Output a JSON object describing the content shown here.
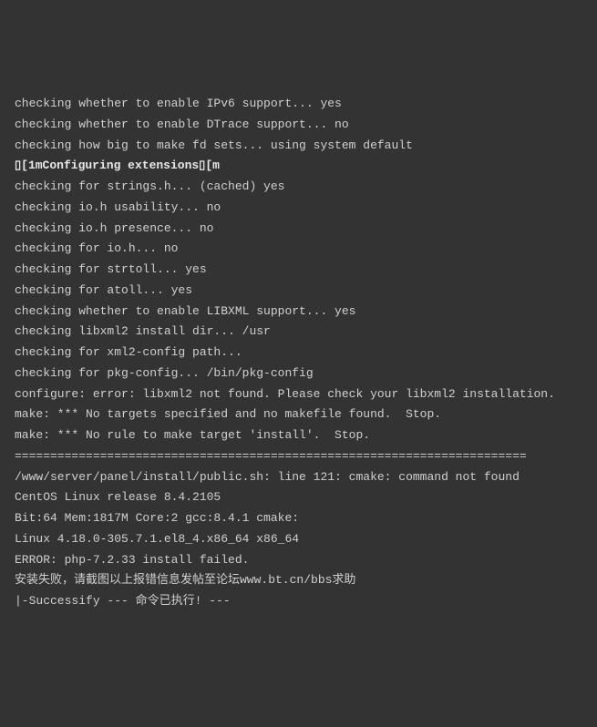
{
  "terminal": {
    "lines": [
      "checking whether to enable IPv6 support... yes",
      "checking whether to enable DTrace support... no",
      "checking how big to make fd sets... using system default",
      "",
      "\u001b[1mConfiguring extensions\u001b[m",
      "checking for strings.h... (cached) yes",
      "checking io.h usability... no",
      "checking io.h presence... no",
      "checking for io.h... no",
      "checking for strtoll... yes",
      "checking for atoll... yes",
      "checking whether to enable LIBXML support... yes",
      "checking libxml2 install dir... /usr",
      "checking for xml2-config path...",
      "checking for pkg-config... /bin/pkg-config",
      "configure: error: libxml2 not found. Please check your libxml2 installation.",
      "make: *** No targets specified and no makefile found.  Stop.",
      "make: *** No rule to make target 'install'.  Stop.",
      "========================================================================",
      "/www/server/panel/install/public.sh: line 121: cmake: command not found",
      "CentOS Linux release 8.4.2105",
      "Bit:64 Mem:1817M Core:2 gcc:8.4.1 cmake:",
      "Linux 4.18.0-305.7.1.el8_4.x86_64 x86_64",
      "ERROR: php-7.2.33 install failed.",
      "安装失败，请截图以上报错信息发帖至论坛www.bt.cn/bbs求助",
      "|-Successify --- 命令已执行! ---"
    ]
  }
}
